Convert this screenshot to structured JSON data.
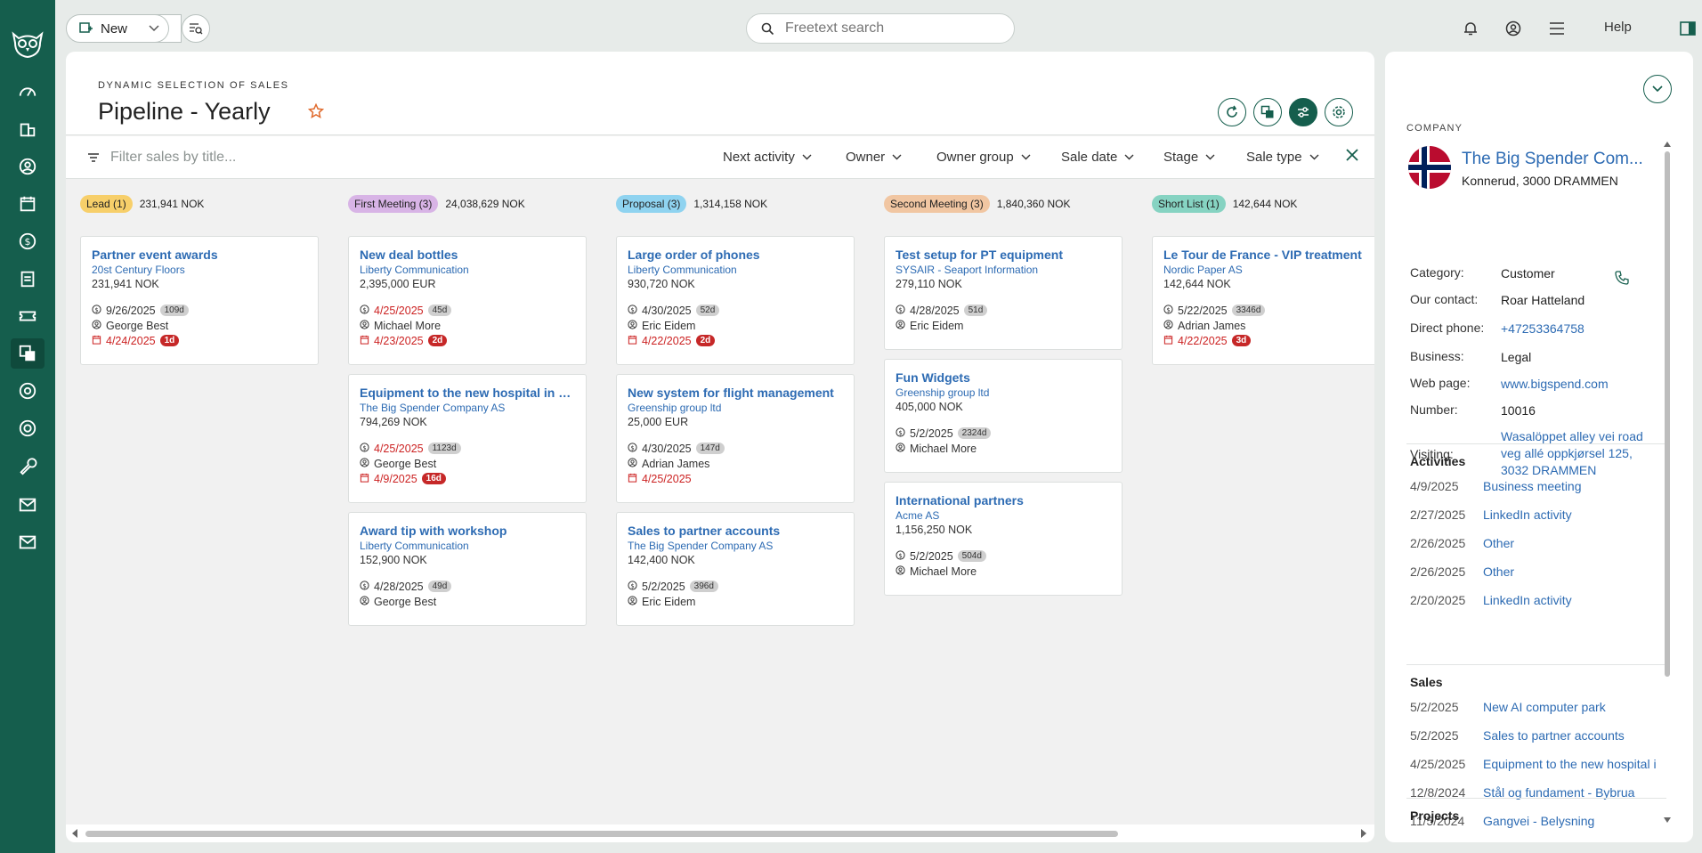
{
  "topbar": {
    "new_label": "New",
    "search_placeholder": "Freetext search",
    "help_label": "Help"
  },
  "header": {
    "subtitle": "DYNAMIC SELECTION OF SALES",
    "title": "Pipeline - Yearly"
  },
  "filterbar": {
    "placeholder": "Filter sales by title...",
    "filters": [
      "Next activity",
      "Owner",
      "Owner group",
      "Sale date",
      "Stage",
      "Sale type"
    ]
  },
  "colors": {
    "brand": "#155e4d",
    "link": "#2d6bb3",
    "overdue": "#c62828",
    "star": "#e06a2c"
  },
  "columns": [
    {
      "label": "Lead (1)",
      "total": "231,941 NOK",
      "badge_color": "#f7cf6a",
      "cards": [
        {
          "title": "Partner event awards",
          "company": "20st Century Floors",
          "amount": "231,941",
          "currency": "NOK",
          "sale_date": "9/26/2025",
          "sale_days": "109d",
          "sale_red": false,
          "owner": "George Best",
          "activity_date": "4/24/2025",
          "activity_days": "1d"
        }
      ]
    },
    {
      "label": "First Meeting (3)",
      "total": "24,038,629 NOK",
      "badge_color": "#d8b4e6",
      "cards": [
        {
          "title": "New deal bottles",
          "company": "Liberty Communication",
          "amount": "2,395,000",
          "currency": "EUR",
          "sale_date": "4/25/2025",
          "sale_days": "45d",
          "sale_red": true,
          "owner": "Michael More",
          "activity_date": "4/23/2025",
          "activity_days": "2d"
        },
        {
          "title": "Equipment to the new hospital in Dr...",
          "company": "The Big Spender Company AS",
          "amount": "794,269",
          "currency": "NOK",
          "sale_date": "4/25/2025",
          "sale_days": "1123d",
          "sale_red": true,
          "owner": "George Best",
          "activity_date": "4/9/2025",
          "activity_days": "16d"
        },
        {
          "title": "Award tip with workshop",
          "company": "Liberty Communication",
          "amount": "152,900",
          "currency": "NOK",
          "sale_date": "4/28/2025",
          "sale_days": "49d",
          "sale_red": false,
          "owner": "George Best"
        }
      ]
    },
    {
      "label": "Proposal (3)",
      "total": "1,314,158 NOK",
      "badge_color": "#8fd3f0",
      "cards": [
        {
          "title": "Large order of phones",
          "company": "Liberty Communication",
          "amount": "930,720",
          "currency": "NOK",
          "sale_date": "4/30/2025",
          "sale_days": "52d",
          "sale_red": false,
          "owner": "Eric Eidem",
          "activity_date": "4/22/2025",
          "activity_days": "2d"
        },
        {
          "title": "New system for flight management",
          "company": "Greenship group ltd",
          "amount": "25,000",
          "currency": "EUR",
          "sale_date": "4/30/2025",
          "sale_days": "147d",
          "sale_red": false,
          "owner": "Adrian James",
          "activity_date": "4/25/2025"
        },
        {
          "title": "Sales to partner accounts",
          "company": "The Big Spender Company AS",
          "amount": "142,400",
          "currency": "NOK",
          "sale_date": "5/2/2025",
          "sale_days": "396d",
          "sale_red": false,
          "owner": "Eric Eidem"
        }
      ]
    },
    {
      "label": "Second Meeting (3)",
      "total": "1,840,360 NOK",
      "badge_color": "#f1c6a2",
      "cards": [
        {
          "title": "Test setup for PT equipment",
          "company": "SYSAIR - Seaport Information",
          "amount": "279,110",
          "currency": "NOK",
          "sale_date": "4/28/2025",
          "sale_days": "51d",
          "sale_red": false,
          "owner": "Eric Eidem"
        },
        {
          "title": "Fun Widgets",
          "company": "Greenship group ltd",
          "amount": "405,000",
          "currency": "NOK",
          "sale_date": "5/2/2025",
          "sale_days": "2324d",
          "sale_red": false,
          "owner": "Michael More"
        },
        {
          "title": "International partners",
          "company": "Acme AS",
          "amount": "1,156,250",
          "currency": "NOK",
          "sale_date": "5/2/2025",
          "sale_days": "504d",
          "sale_red": false,
          "owner": "Michael More"
        }
      ]
    },
    {
      "label": "Short List (1)",
      "total": "142,644 NOK",
      "badge_color": "#86d3c2",
      "cards": [
        {
          "title": "Le Tour de France - VIP treatment",
          "company": "Nordic Paper AS",
          "amount": "142,644",
          "currency": "NOK",
          "sale_date": "5/22/2025",
          "sale_days": "3346d",
          "sale_red": false,
          "owner": "Adrian James",
          "activity_date": "4/22/2025",
          "activity_days": "3d"
        }
      ]
    }
  ],
  "company_panel": {
    "section_label": "COMPANY",
    "name": "The Big Spender Com...",
    "address": "Konnerud, 3000 DRAMMEN",
    "fields": [
      {
        "label": "Category:",
        "value": "Customer",
        "link": false
      },
      {
        "label": "Our contact:",
        "value": "Roar Hatteland",
        "link": false
      },
      {
        "label": "Direct phone:",
        "value": "+47253364758",
        "link": true
      },
      {
        "label": "Business:",
        "value": "Legal",
        "link": false
      },
      {
        "label": "Web page:",
        "value": "www.bigspend.com",
        "link": true
      },
      {
        "label": "Number:",
        "value": "10016",
        "link": false
      },
      {
        "label": "Visiting:",
        "value": "Wasalöppet alley vei road veg allé oppkjørsel 125, 3032 DRAMMEN",
        "link": true
      }
    ],
    "activities_title": "Activities",
    "activities": [
      {
        "date": "4/9/2025",
        "text": "Business meeting"
      },
      {
        "date": "2/27/2025",
        "text": "LinkedIn activity"
      },
      {
        "date": "2/26/2025",
        "text": "Other"
      },
      {
        "date": "2/26/2025",
        "text": "Other"
      },
      {
        "date": "2/20/2025",
        "text": "LinkedIn activity"
      }
    ],
    "sales_title": "Sales",
    "sales": [
      {
        "date": "5/2/2025",
        "text": "New AI computer park"
      },
      {
        "date": "5/2/2025",
        "text": "Sales to partner accounts"
      },
      {
        "date": "4/25/2025",
        "text": "Equipment to the new hospital i"
      },
      {
        "date": "12/8/2024",
        "text": "Stål og fundament - Bybrua"
      },
      {
        "date": "11/5/2024",
        "text": "Gangvei - Belysning"
      }
    ],
    "projects_title": "Projects"
  }
}
